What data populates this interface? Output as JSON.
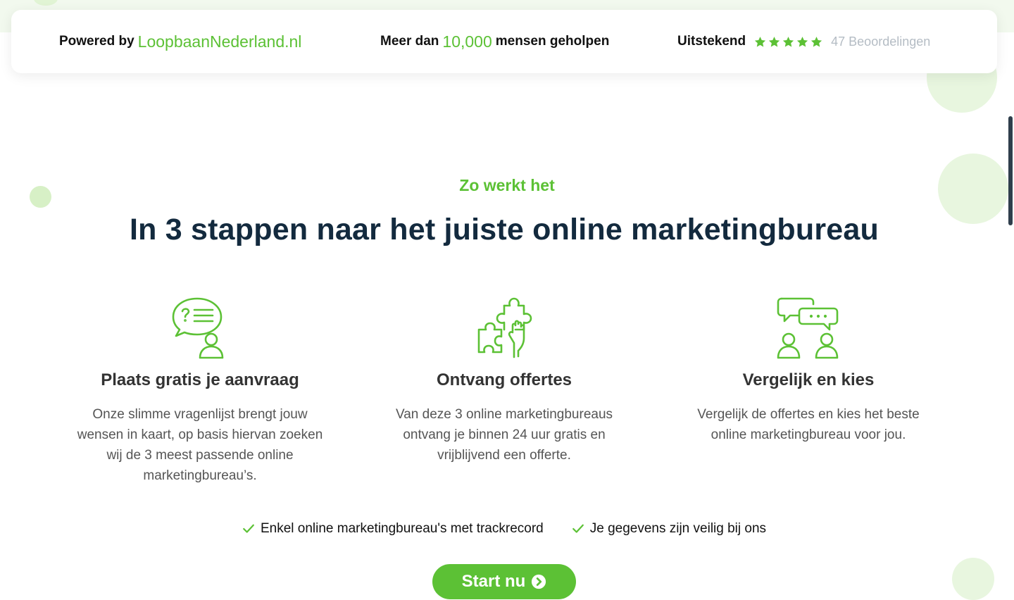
{
  "trustbar": {
    "powered_prefix": "Powered by",
    "powered_brand": "LoopbaanNederland.nl",
    "helped_prefix": "Meer dan",
    "helped_count": "10,000",
    "helped_suffix": "mensen geholpen",
    "rating_label": "Uitstekend",
    "rating_stars": 5,
    "reviews": "47 Beoordelingen"
  },
  "section": {
    "eyebrow": "Zo werkt het",
    "headline": "In 3 stappen naar het juiste online marketingbureau"
  },
  "steps": [
    {
      "icon": "chat-question-icon",
      "title": "Plaats gratis je aanvraag",
      "description": "Onze slimme vragenlijst brengt jouw wensen in kaart, op basis hiervan zoeken wij de 3 meest passende online marketingbureau’s."
    },
    {
      "icon": "puzzle-hand-icon",
      "title": "Ontvang offertes",
      "description": "Van deze 3 online marketingbureaus ontvang je binnen 24 uur gratis en vrijblijvend een offerte."
    },
    {
      "icon": "compare-people-icon",
      "title": "Vergelijk en kies",
      "description": "Vergelijk de offertes en kies het beste online marketingbureau voor jou."
    }
  ],
  "checks": [
    "Enkel online marketingbureau's met trackrecord",
    "Je gegevens zijn veilig bij ons"
  ],
  "cta": {
    "label": "Start nu",
    "icon": "chevron-circle-right-icon"
  },
  "colors": {
    "accent": "#5cc135",
    "heading": "#132a3e",
    "muted": "#b4bcc4"
  }
}
